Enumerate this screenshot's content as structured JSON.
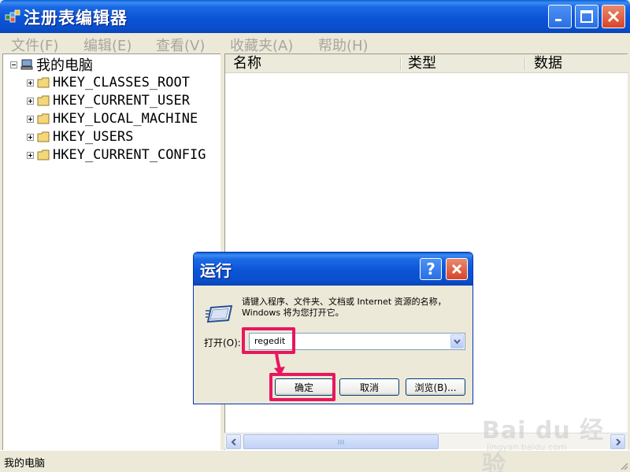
{
  "window": {
    "title": "注册表编辑器",
    "controls": {
      "minimize": "minimize",
      "maximize": "maximize",
      "close": "close"
    }
  },
  "menu": [
    {
      "label": "文件(F)"
    },
    {
      "label": "编辑(E)"
    },
    {
      "label": "查看(V)"
    },
    {
      "label": "收藏夹(A)"
    },
    {
      "label": "帮助(H)"
    }
  ],
  "tree": {
    "root": "我的电脑",
    "items": [
      {
        "label": "HKEY_CLASSES_ROOT"
      },
      {
        "label": "HKEY_CURRENT_USER"
      },
      {
        "label": "HKEY_LOCAL_MACHINE"
      },
      {
        "label": "HKEY_USERS"
      },
      {
        "label": "HKEY_CURRENT_CONFIG"
      }
    ]
  },
  "list": {
    "columns": [
      {
        "label": "名称"
      },
      {
        "label": "类型"
      },
      {
        "label": "数据"
      }
    ]
  },
  "statusbar": {
    "text": "我的电脑"
  },
  "run_dialog": {
    "title": "运行",
    "help_label": "?",
    "description": "请键入程序、文件夹、文档或 Internet 资源的名称，Windows 将为您打开它。",
    "open_label": "打开(O):",
    "open_value": "regedit",
    "buttons": {
      "ok": "确定",
      "cancel": "取消",
      "browse": "浏览(B)..."
    }
  },
  "watermark": {
    "brand": "Bai du 经验",
    "url": "jingyan.baidu.com"
  },
  "colors": {
    "titlebar": "#0b54d6",
    "highlight": "#e8175d",
    "window_bg": "#ece9d8"
  }
}
